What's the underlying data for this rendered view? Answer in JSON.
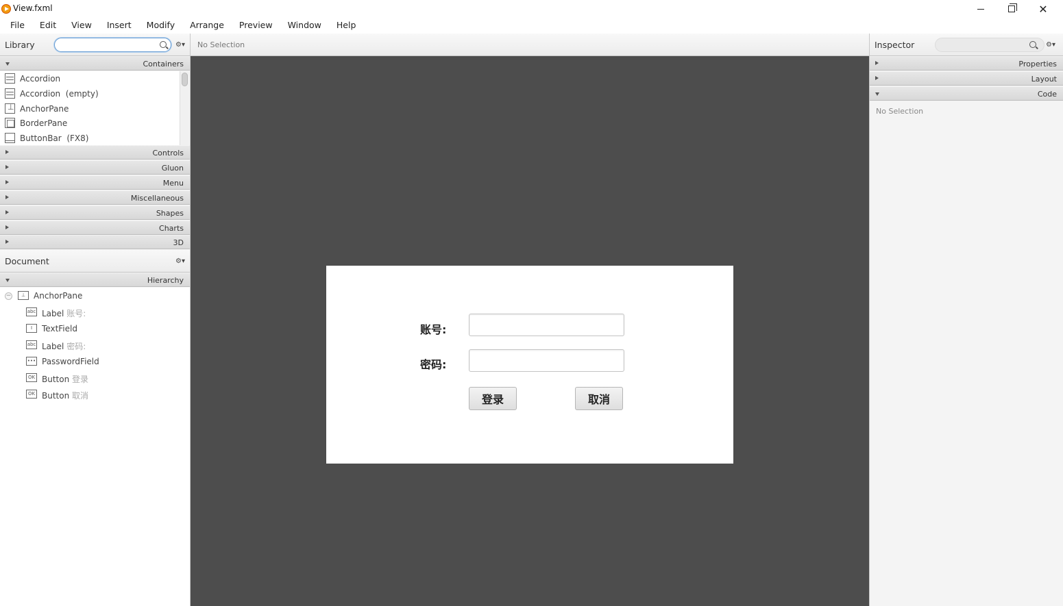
{
  "window": {
    "title": "View.fxml",
    "controls": [
      "minimize",
      "restore",
      "close"
    ]
  },
  "menubar": {
    "items": [
      "File",
      "Edit",
      "View",
      "Insert",
      "Modify",
      "Arrange",
      "Preview",
      "Window",
      "Help"
    ]
  },
  "library": {
    "title": "Library",
    "search_value": "",
    "search_icon": "search-icon",
    "gear_icon": "gear-icon",
    "sections": [
      {
        "label": "Containers",
        "expanded": true
      },
      {
        "label": "Controls",
        "expanded": false
      },
      {
        "label": "Gluon",
        "expanded": false
      },
      {
        "label": "Menu",
        "expanded": false
      },
      {
        "label": "Miscellaneous",
        "expanded": false
      },
      {
        "label": "Shapes",
        "expanded": false
      },
      {
        "label": "Charts",
        "expanded": false
      },
      {
        "label": "3D",
        "expanded": false
      }
    ],
    "containers": [
      {
        "label": "Accordion",
        "icon": "accordion-icon"
      },
      {
        "label": "Accordion  (empty)",
        "icon": "accordion-icon"
      },
      {
        "label": "AnchorPane",
        "icon": "anchorpane-icon"
      },
      {
        "label": "BorderPane",
        "icon": "borderpane-icon"
      },
      {
        "label": "ButtonBar  (FX8)",
        "icon": "buttonbar-icon"
      }
    ]
  },
  "document": {
    "title": "Document",
    "section": "Hierarchy",
    "tree": [
      {
        "type": "AnchorPane",
        "detail": "",
        "icon": "anchorpane-icon"
      },
      {
        "type": "Label",
        "detail": "账号:",
        "icon": "label-icon"
      },
      {
        "type": "TextField",
        "detail": "",
        "icon": "textfield-icon"
      },
      {
        "type": "Label",
        "detail": "密码:",
        "icon": "label-icon"
      },
      {
        "type": "PasswordField",
        "detail": "",
        "icon": "passwordfield-icon"
      },
      {
        "type": "Button",
        "detail": "登录",
        "icon": "button-icon"
      },
      {
        "type": "Button",
        "detail": "取消",
        "icon": "button-icon"
      }
    ]
  },
  "center": {
    "status": "No Selection"
  },
  "form": {
    "account_label": "账号:",
    "account_value": "",
    "password_label": "密码:",
    "password_value": "",
    "login_button": "登录",
    "cancel_button": "取消"
  },
  "inspector": {
    "title": "Inspector",
    "sections": [
      {
        "label": "Properties",
        "expanded": false
      },
      {
        "label": "Layout",
        "expanded": false
      },
      {
        "label": "Code",
        "expanded": true
      }
    ],
    "status": "No Selection"
  },
  "colors": {
    "canvas_bg": "#4d4d4d",
    "panel_bg": "#f4f4f4",
    "search_focus": "#6a9ed3"
  }
}
